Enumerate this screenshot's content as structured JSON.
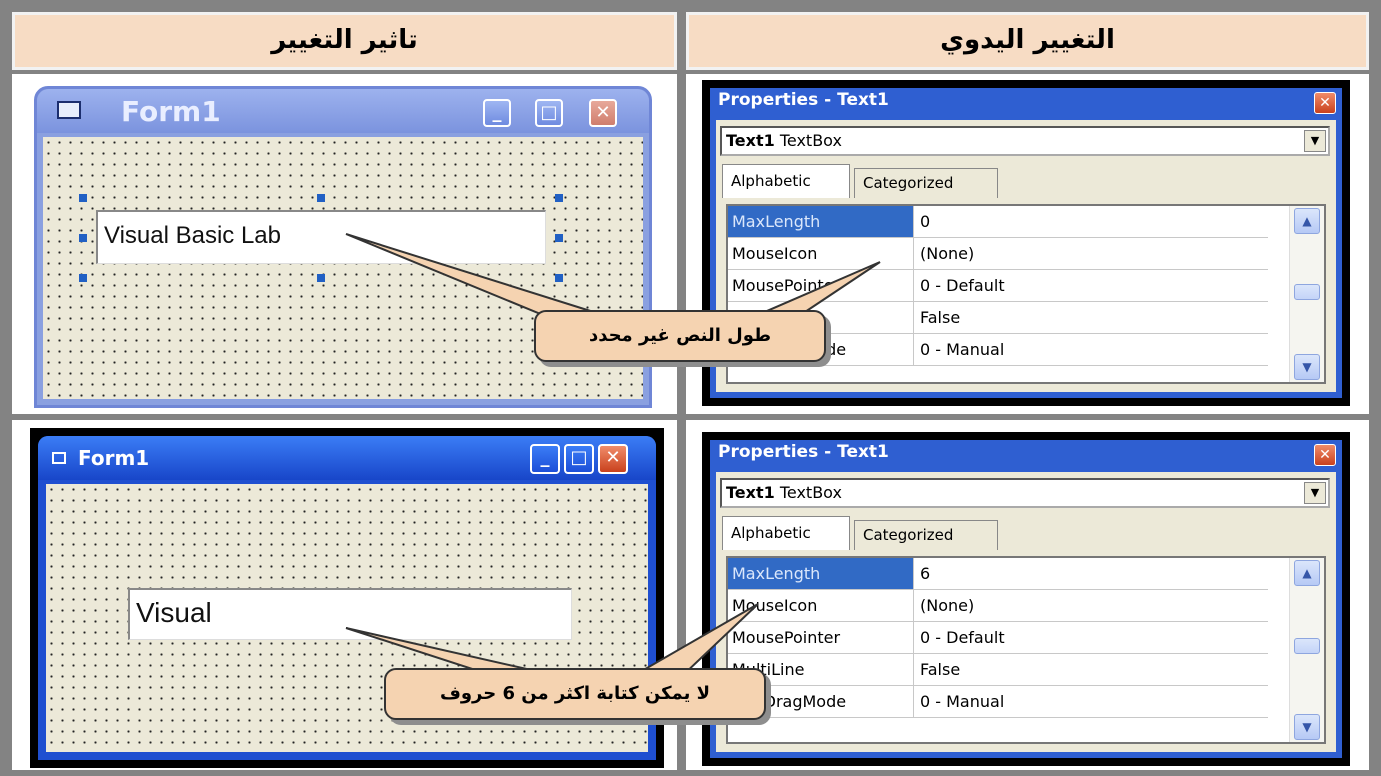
{
  "headers": {
    "effect": "تاثير التغيير",
    "manual": "التغيير اليدوي"
  },
  "top_form": {
    "title": "Form1",
    "textbox_text": "Visual Basic Lab",
    "minimize_icon": "minimize-icon",
    "maximize_icon": "maximize-icon",
    "close_icon": "close-icon"
  },
  "bottom_form": {
    "title": "Form1",
    "textbox_text": "Visual"
  },
  "top_props": {
    "title": "Properties - Text1",
    "object_name": "Text1",
    "object_type": "TextBox",
    "tabs": [
      "Alphabetic",
      "Categorized"
    ],
    "rows": [
      {
        "name": "MaxLength",
        "value": "0"
      },
      {
        "name": "MouseIcon",
        "value": "(None)"
      },
      {
        "name": "MousePointer",
        "value": "0 - Default"
      },
      {
        "name": "MultiLine",
        "value": "False"
      },
      {
        "name": "OLEDragMode",
        "value": "0 - Manual"
      }
    ]
  },
  "bottom_props": {
    "title": "Properties - Text1",
    "object_name": "Text1",
    "object_type": "TextBox",
    "tabs": [
      "Alphabetic",
      "Categorized"
    ],
    "rows": [
      {
        "name": "MaxLength",
        "value": "6"
      },
      {
        "name": "MouseIcon",
        "value": "(None)"
      },
      {
        "name": "MousePointer",
        "value": "0 - Default"
      },
      {
        "name": "MultiLine",
        "value": "False"
      },
      {
        "name": "OLEDragMode",
        "value": "0 - Manual"
      }
    ]
  },
  "callouts": {
    "top": "طول النص غير محدد",
    "bottom": "لا يمكن كتابة اكثر من 6 حروف"
  },
  "colors": {
    "header_bg": "#f7dcc4",
    "callout_bg": "#f5d3b1",
    "title_blue": "#2f5fd1",
    "selection_blue": "#316ac5"
  }
}
